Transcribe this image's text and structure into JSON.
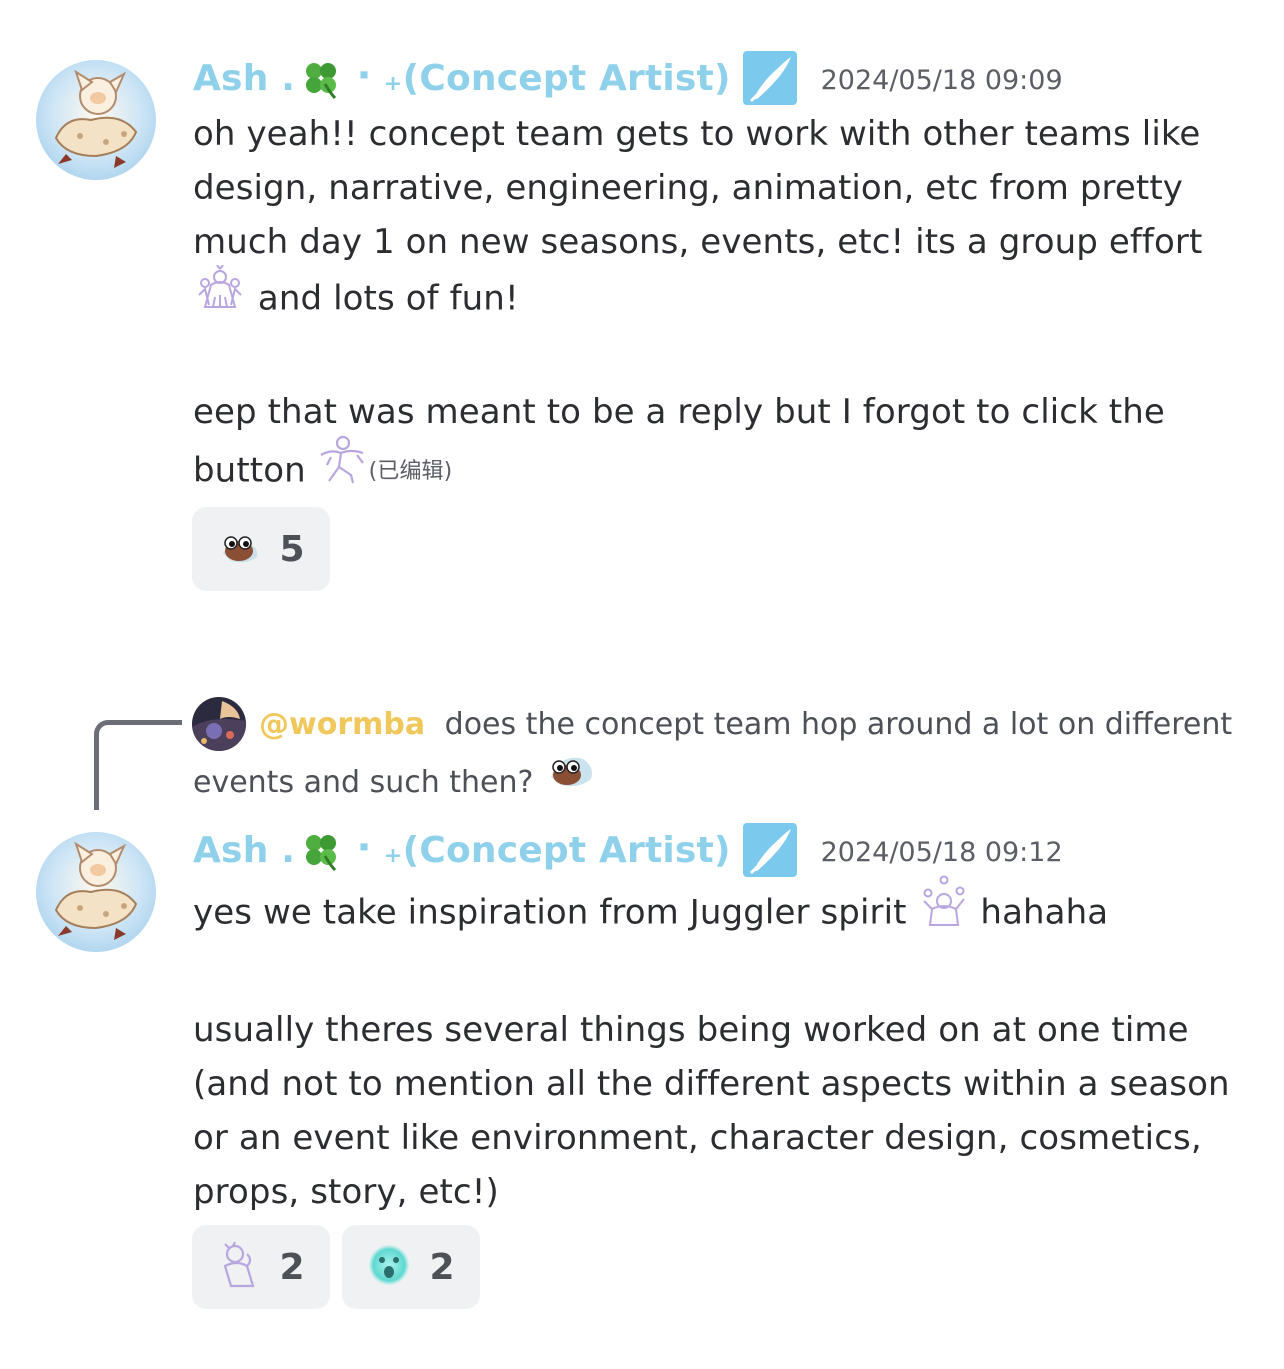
{
  "messages": [
    {
      "username": "Ash .",
      "username_suffix": "⠂₊(Concept Artist)",
      "timestamp": "2024/05/18 09:09",
      "paragraphs": {
        "p1_text": "oh yeah!! concept team gets to work with other teams like design, narrative, engineering, animation, etc from pretty much day 1 on new seasons, events, etc! its a group effort",
        "p1_after": "and lots of fun!",
        "p2_text": "eep that was meant to be a reply but I forgot to click the button",
        "edited": "(已编辑)"
      },
      "reactions": [
        {
          "emoji": "krill-eyes-emoji",
          "count": "5"
        }
      ]
    },
    {
      "reply": {
        "mention": "@wormba",
        "text": "does the concept team hop around a lot on different events and such then?"
      },
      "username": "Ash .",
      "username_suffix": "⠂₊(Concept Artist)",
      "timestamp": "2024/05/18 09:12",
      "paragraphs": {
        "p1_before": "yes we take inspiration from Juggler spirit",
        "p1_after": "hahaha",
        "p2_text": "usually theres several things being worked on at one time (and not to mention all the different aspects within a season or an event like environment, character design, cosmetics, props, story, etc!)"
      },
      "reactions": [
        {
          "emoji": "thinking-spirit-emoji",
          "count": "2"
        },
        {
          "emoji": "wow-face-emoji",
          "count": "2"
        }
      ]
    }
  ],
  "colors": {
    "username": "#8fd0ea",
    "mention": "#f0c75a",
    "badge": "#7cc9ee",
    "reaction_bg": "#f0f1f3",
    "emoji_outline": "#b9a6e0"
  }
}
